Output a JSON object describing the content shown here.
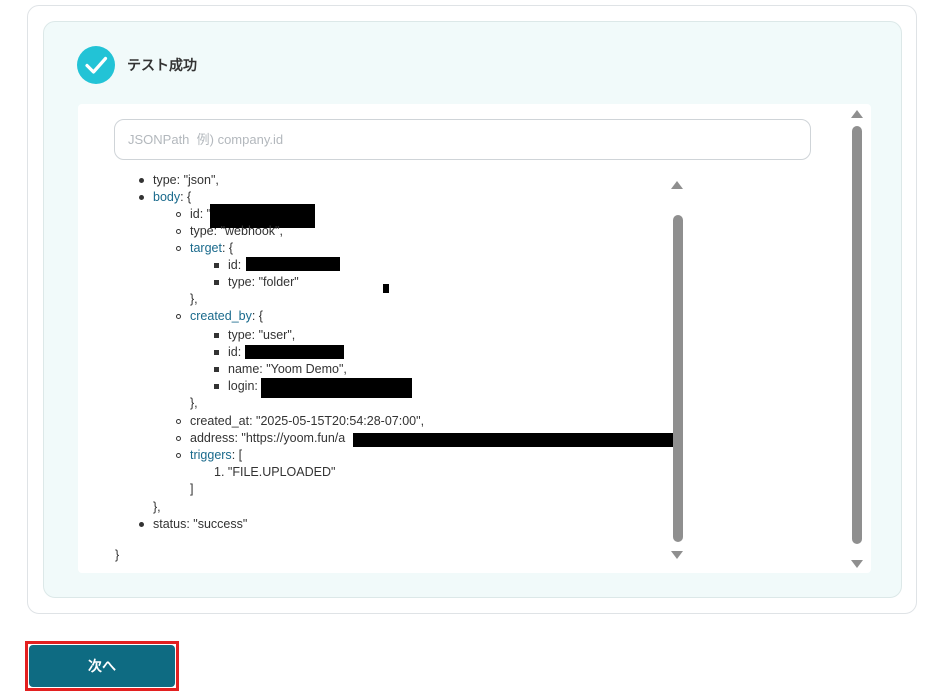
{
  "result": {
    "title": "テスト成功",
    "icon": "check-circle-icon",
    "accent_color": "#22c3d6"
  },
  "jsonpath": {
    "placeholder": "JSONPath  例) company.id",
    "value": ""
  },
  "json_tree": {
    "type_line": "type: \"json\",",
    "body_key": "body",
    "body_open": ": {",
    "body_id_key": "id: \"",
    "body_type": "type: \"webhook\",",
    "target_key": "target",
    "target_open": ": {",
    "target_id": "id:",
    "target_type": "type: \"folder\"",
    "target_close": "},",
    "created_by_key": "created_by",
    "created_by_open": ": {",
    "created_by_type": "type: \"user\",",
    "created_by_id": "id:",
    "created_by_name": "name: \"Yoom Demo\",",
    "created_by_login": "login:",
    "created_by_close": "},",
    "created_at": "created_at: \"2025-05-15T20:54:28-07:00\",",
    "address": "address: \"https://yoom.fun/a",
    "triggers_key": "triggers",
    "triggers_open": ": [",
    "trigger_item": "1. \"FILE.UPLOADED\"",
    "triggers_close": "]",
    "body_close": "},",
    "status": "status: \"success\"",
    "root_close": "}"
  },
  "footer": {
    "next_label": "次へ",
    "button_color": "#0e6b82",
    "highlight_color": "#e32020"
  }
}
